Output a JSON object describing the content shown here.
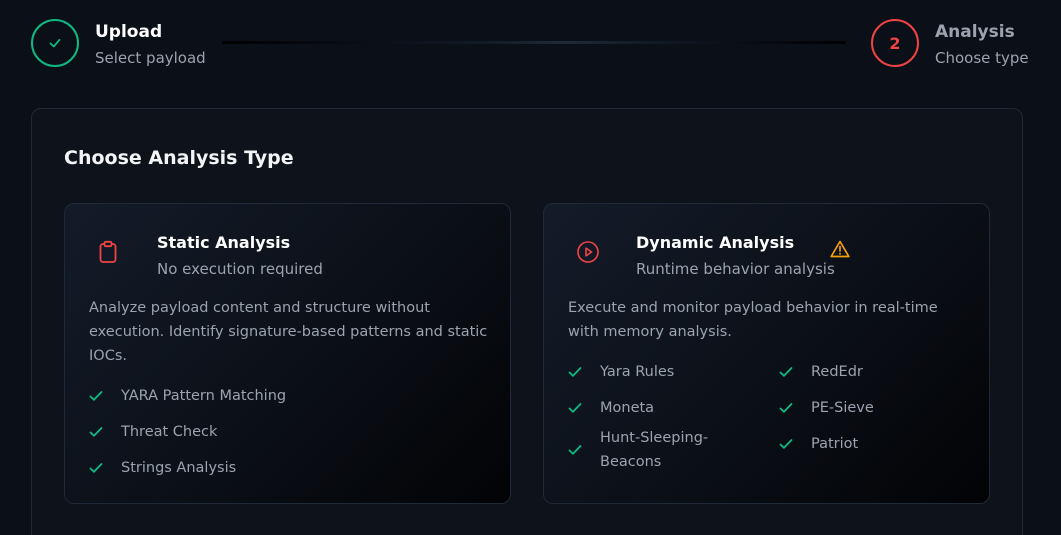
{
  "stepper": {
    "steps": [
      {
        "title": "Upload",
        "subtitle": "Select payload",
        "state": "done",
        "icon": "check-icon"
      },
      {
        "title": "Analysis",
        "subtitle": "Choose type",
        "state": "active",
        "number": "2"
      }
    ]
  },
  "panel": {
    "title": "Choose Analysis Type",
    "cards": [
      {
        "title": "Static Analysis",
        "subtitle": "No execution required",
        "icon": "clipboard-icon",
        "description": "Analyze payload content and structure without execution. Identify signature-based patterns and static IOCs.",
        "features": [
          "YARA Pattern Matching",
          "Threat Check",
          "Strings Analysis"
        ]
      },
      {
        "title": "Dynamic Analysis",
        "subtitle": "Runtime behavior analysis",
        "icon": "play-circle-icon",
        "warning_icon": "warning-triangle-icon",
        "description": "Execute and monitor payload behavior in real-time with memory analysis.",
        "features_col1": [
          "Yara Rules",
          "Moneta",
          "Hunt-Sleeping-Beacons"
        ],
        "features_col2": [
          "RedEdr",
          "PE-Sieve",
          "Patriot"
        ]
      }
    ]
  },
  "colors": {
    "success": "#10b981",
    "danger": "#ef4444",
    "warning": "#f59e0b",
    "background": "#0b0f17"
  }
}
